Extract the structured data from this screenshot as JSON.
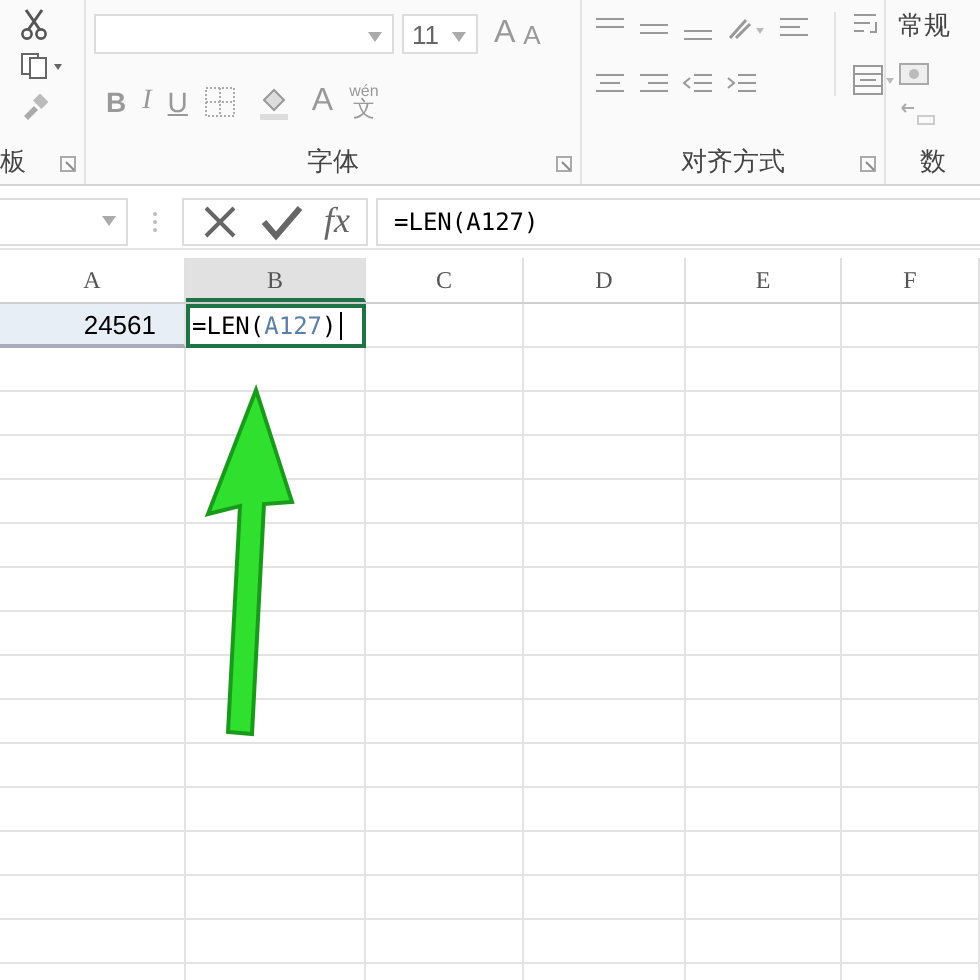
{
  "ribbon": {
    "groups": [
      {
        "label": "板",
        "kind": "clipboard"
      },
      {
        "label": "字体",
        "kind": "font"
      },
      {
        "label": "对齐方式",
        "kind": "alignment"
      },
      {
        "label": "数",
        "kind": "number"
      }
    ],
    "font_size": "11",
    "grow_font": "A",
    "shrink_font": "A",
    "bold": "B",
    "italic": "I",
    "underline": "U",
    "font_color": "A",
    "phonetic_top": "wén",
    "phonetic_bottom": "文",
    "number_format": "常规"
  },
  "formula_bar": {
    "function_symbol": "fx",
    "formula": "=LEN(A127)"
  },
  "sheet": {
    "columns": [
      {
        "label": "A",
        "selected": false
      },
      {
        "label": "B",
        "selected": true
      },
      {
        "label": "C",
        "selected": false
      },
      {
        "label": "D",
        "selected": false
      },
      {
        "label": "E",
        "selected": false
      },
      {
        "label": "F",
        "selected": false
      }
    ],
    "first_row": {
      "a": "24561"
    },
    "active_cell": {
      "parts": [
        {
          "text": "=LEN(",
          "kind": "plain"
        },
        {
          "text": "A127",
          "kind": "reference"
        },
        {
          "text": ")",
          "kind": "plain"
        }
      ]
    }
  }
}
